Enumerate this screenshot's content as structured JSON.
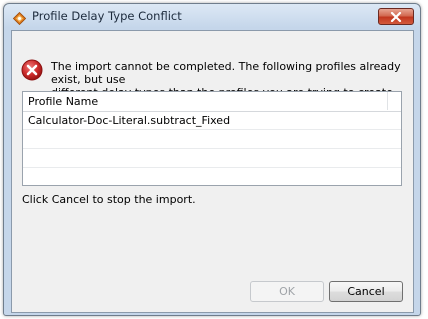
{
  "window": {
    "title": "Profile Delay Type Conflict",
    "icon": "app-diamond-icon"
  },
  "titlebar": {
    "close_icon": "close-icon"
  },
  "message": {
    "icon": "error-icon",
    "text": "The import cannot be completed. The following profiles already exist, but use\ndifferent delay types than the profiles you are trying to create."
  },
  "table": {
    "columns": [
      "Profile Name"
    ],
    "rows": [
      "Calculator-Doc-Literal.subtract_Fixed",
      "",
      "",
      "",
      ""
    ]
  },
  "hint": "Click Cancel to stop the import.",
  "buttons": {
    "ok_label": "OK",
    "ok_enabled": false,
    "cancel_label": "Cancel"
  },
  "colors": {
    "title_bar": "#c5d6ea",
    "close_button": "#c2371f",
    "error_icon": "#cc2b2b",
    "app_icon": "#e07b1e"
  }
}
